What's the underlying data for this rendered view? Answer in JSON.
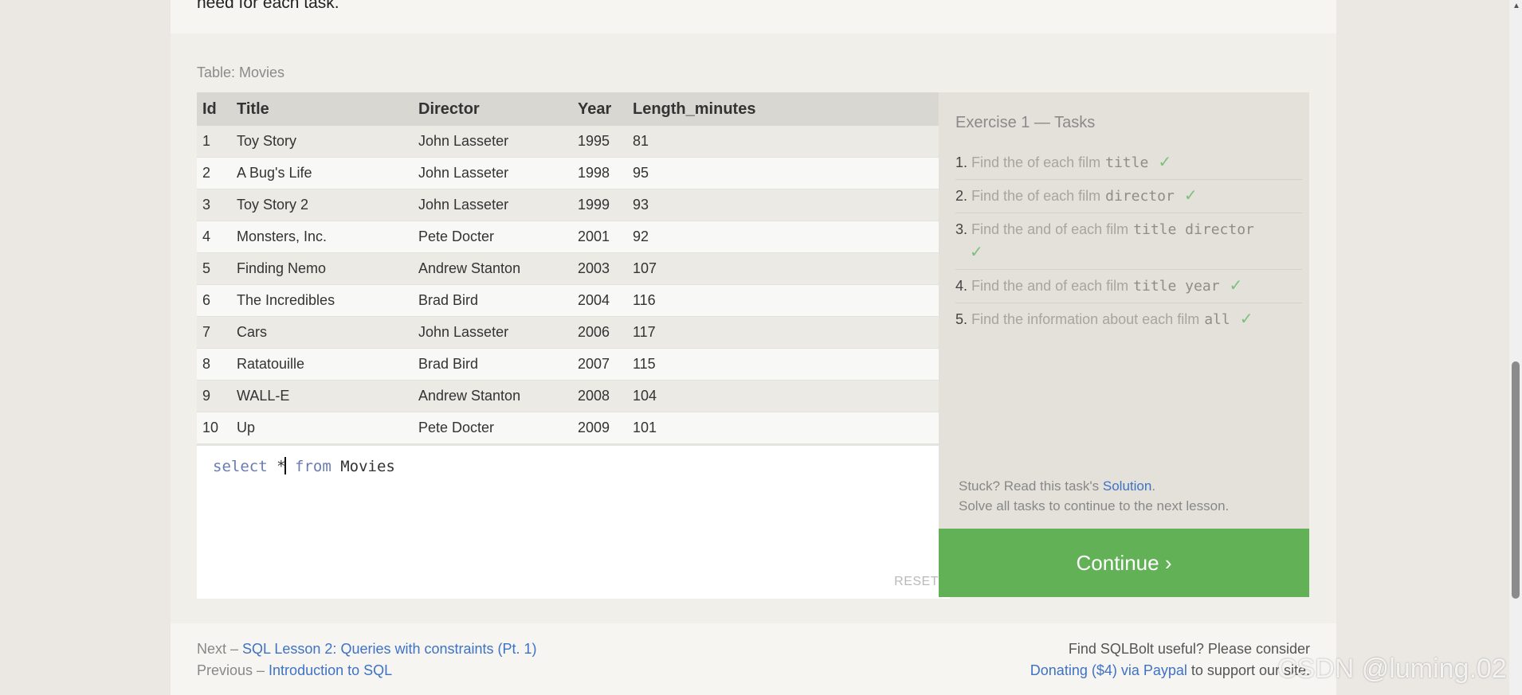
{
  "intro": {
    "text": "need for each task."
  },
  "table": {
    "label": "Table: Movies",
    "columns": [
      "Id",
      "Title",
      "Director",
      "Year",
      "Length_minutes"
    ],
    "rows": [
      [
        "1",
        "Toy Story",
        "John Lasseter",
        "1995",
        "81"
      ],
      [
        "2",
        "A Bug's Life",
        "John Lasseter",
        "1998",
        "95"
      ],
      [
        "3",
        "Toy Story 2",
        "John Lasseter",
        "1999",
        "93"
      ],
      [
        "4",
        "Monsters, Inc.",
        "Pete Docter",
        "2001",
        "92"
      ],
      [
        "5",
        "Finding Nemo",
        "Andrew Stanton",
        "2003",
        "107"
      ],
      [
        "6",
        "The Incredibles",
        "Brad Bird",
        "2004",
        "116"
      ],
      [
        "7",
        "Cars",
        "John Lasseter",
        "2006",
        "117"
      ],
      [
        "8",
        "Ratatouille",
        "Brad Bird",
        "2007",
        "115"
      ],
      [
        "9",
        "WALL-E",
        "Andrew Stanton",
        "2008",
        "104"
      ],
      [
        "10",
        "Up",
        "Pete Docter",
        "2009",
        "101"
      ]
    ]
  },
  "editor": {
    "kw_select": "select",
    "star": "*",
    "kw_from": "from",
    "table_name": "Movies",
    "reset_label": "RESET"
  },
  "tasks": {
    "title": "Exercise 1 — Tasks",
    "items": [
      {
        "num": "1.",
        "text": "Find the of each film",
        "code": "title",
        "check": "✓"
      },
      {
        "num": "2.",
        "text": "Find the of each film",
        "code": "director",
        "check": "✓"
      },
      {
        "num": "3.",
        "text": "Find the and of each film",
        "code": "title director",
        "check": "✓"
      },
      {
        "num": "4.",
        "text": "Find the and of each film",
        "code": "title year",
        "check": "✓"
      },
      {
        "num": "5.",
        "text": "Find the information about each film",
        "code": "all",
        "check": "✓"
      }
    ],
    "stuck_prefix": "Stuck? Read this task's ",
    "solution_link": "Solution",
    "stuck_suffix": ".",
    "solve_all": "Solve all tasks to continue to the next lesson."
  },
  "continue_label": "Continue ›",
  "footer": {
    "next_prefix": "Next – ",
    "next_link": "SQL Lesson 2: Queries with constraints (Pt. 1)",
    "prev_prefix": "Previous – ",
    "prev_link": "Introduction to SQL",
    "useful_text": "Find SQLBolt useful? Please consider",
    "donate_link": "Donating ($4) via Paypal",
    "donate_suffix": " to support our site."
  },
  "watermark": "CSDN @luming.02",
  "colors": {
    "continue_bg": "#62b157",
    "link": "#3e72c4",
    "check": "#7cc07c"
  }
}
